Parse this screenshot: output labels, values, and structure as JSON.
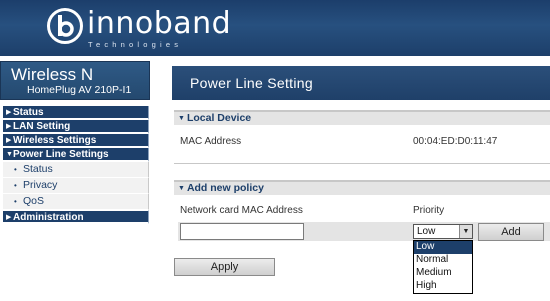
{
  "brand": {
    "name": "innoband",
    "tagline": "Technologies"
  },
  "product": {
    "name": "Wireless N",
    "model": "HomePlug AV 210P-I1"
  },
  "nav": {
    "status": "Status",
    "lan": "LAN Setting",
    "wireless": "Wireless Settings",
    "powerline": "Power Line Settings",
    "powerline_items": [
      "Status",
      "Privacy",
      "QoS"
    ],
    "administration": "Administration"
  },
  "page": {
    "title": "Power Line Setting"
  },
  "local_device": {
    "header": "Local Device",
    "mac_label": "MAC Address",
    "mac_value": "00:04:ED:D0:11:47"
  },
  "new_policy": {
    "header": "Add new policy",
    "mac_label": "Network card MAC Address",
    "mac_value": "",
    "priority_label": "Priority",
    "priority_selected": "Low",
    "priority_options": [
      "Low",
      "Normal",
      "Medium",
      "High"
    ],
    "add_button": "Add"
  },
  "apply_button": "Apply",
  "colors": {
    "navy": "#1d3f6a",
    "header_blue": "#27507f",
    "section_grey": "#e4e4e4"
  }
}
